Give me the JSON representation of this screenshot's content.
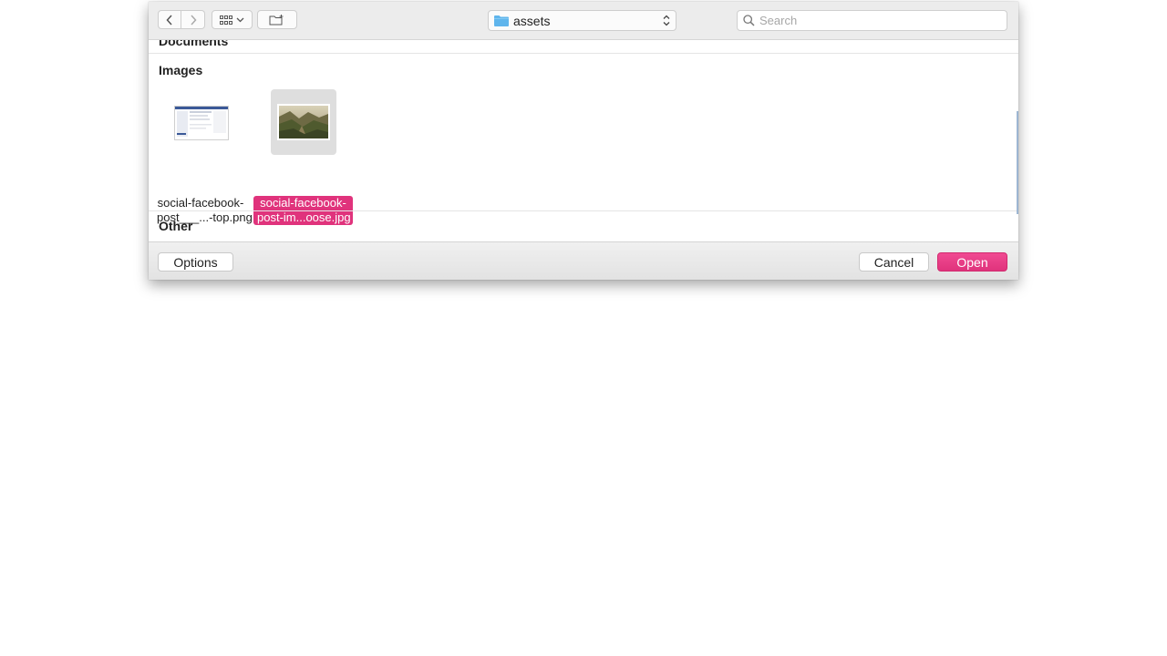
{
  "toolbar": {
    "location": "assets",
    "search_placeholder": "Search"
  },
  "sections": {
    "documents": "Documents",
    "images": "Images",
    "other": "Other"
  },
  "files": [
    {
      "line1": "social-facebook-",
      "line2": "post___...-top.png",
      "selected": false
    },
    {
      "line1": "social-facebook-",
      "line2": "post-im...oose.jpg",
      "selected": true
    }
  ],
  "footer": {
    "options_label": "Options",
    "cancel_label": "Cancel",
    "open_label": "Open"
  },
  "colors": {
    "accent": "#e0337c",
    "folder_icon": "#5fb5ec",
    "toolbar_bg": "#ececec"
  }
}
